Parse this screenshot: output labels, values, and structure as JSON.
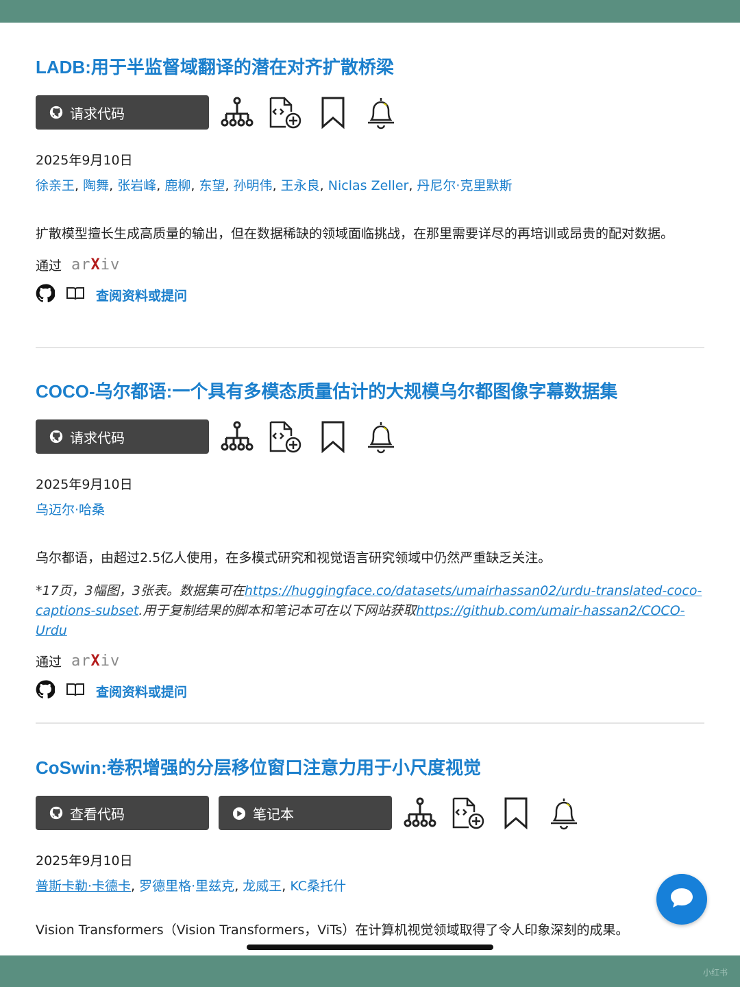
{
  "papers": [
    {
      "title": "LADB:用于半监督域翻译的潜在对齐扩散桥梁",
      "buttons": [
        "请求代码"
      ],
      "date": "2025年9月10日",
      "authors": [
        "徐亲王",
        "陶舞",
        "张岩峰",
        "鹿柳",
        "东望",
        "孙明伟",
        "王永良",
        "Niclas Zeller",
        "丹尼尔·克里默斯"
      ],
      "abstract": "扩散模型擅长生成高质量的输出，但在数据稀缺的领域面临挑战，在那里需要详尽的再培训或昂贵的配对数据。",
      "via": "通过",
      "ask": "查阅资料或提问"
    },
    {
      "title": "COCO-乌尔都语:一个具有多模态质量估计的大规模乌尔都图像字幕数据集",
      "buttons": [
        "请求代码"
      ],
      "date": "2025年9月10日",
      "authors": [
        "乌迈尔·哈桑"
      ],
      "abstract": "乌尔都语，由超过2.5亿人使用，在多模式研究和视觉语言研究领域中仍然严重缺乏关注。",
      "note_prefix": "*17页，3幅图，3张表。数据集可在",
      "note_link1": "https://huggingface.co/datasets/umairhassan02/urdu-translated-coco-captions-subset",
      "note_middle": ".用于复制结果的脚本和笔记本可在以下网站获取",
      "note_link2": "https://github.com/umair-hassan2/COCO-Urdu",
      "via": "通过",
      "ask": "查阅资料或提问"
    },
    {
      "title": "CoSwin:卷积增强的分层移位窗口注意力用于小尺度视觉",
      "buttons": [
        "查看代码",
        "笔记本"
      ],
      "date": "2025年9月10日",
      "authors": [
        "普斯卡勒·卡德卡",
        "罗德里格·里兹克",
        "龙威王",
        "KC桑托什"
      ],
      "abstract": "Vision Transformers（Vision Transformers，ViTs）在计算机视觉领域取得了令人印象深刻的成果。"
    }
  ],
  "watermark": "小红书",
  "icons": [
    "github-icon",
    "hierarchy-icon",
    "add-file-icon",
    "bookmark-icon",
    "bell-icon",
    "book-icon",
    "play-icon",
    "chat-icon"
  ],
  "colors": {
    "link": "#1b7fcc",
    "button": "#444444",
    "bar": "#5a8f80",
    "fab": "#1780d9"
  }
}
